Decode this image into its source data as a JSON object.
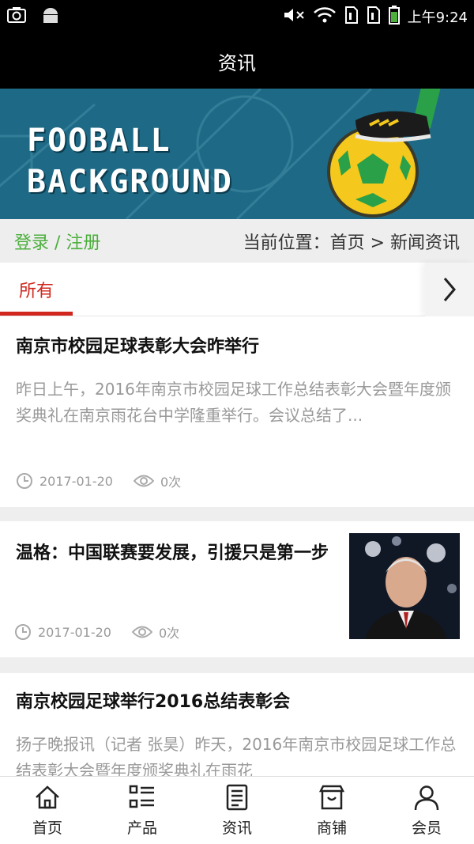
{
  "status_bar": {
    "time": "上午9:24"
  },
  "header": {
    "title": "资讯"
  },
  "banner": {
    "line1": "FOOBALL",
    "line2": "BACKGROUND"
  },
  "crumbs": {
    "login": "登录 / 注册",
    "location": "当前位置：首页 > 新闻资讯"
  },
  "tabs": {
    "active": "所有"
  },
  "articles": [
    {
      "title": "南京市校园足球表彰大会昨举行",
      "summary": "昨日上午，2016年南京市校园足球工作总结表彰大会暨年度颁奖典礼在南京雨花台中学隆重举行。会议总结了...",
      "date": "2017-01-20",
      "views": "0次"
    },
    {
      "title": "温格：中国联赛要发展，引援只是第一步",
      "date": "2017-01-20",
      "views": "0次"
    },
    {
      "title": "南京校园足球举行2016总结表彰会",
      "summary": "扬子晚报讯（记者 张昊）昨天，2016年南京市校园足球工作总结表彰大会暨年度颁奖典礼在雨花"
    }
  ],
  "nav": [
    "首页",
    "产品",
    "资讯",
    "商铺",
    "会员"
  ],
  "colors": {
    "accent": "#d0261d",
    "login": "#4caf3c",
    "banner_bg": "#1e6a86"
  }
}
